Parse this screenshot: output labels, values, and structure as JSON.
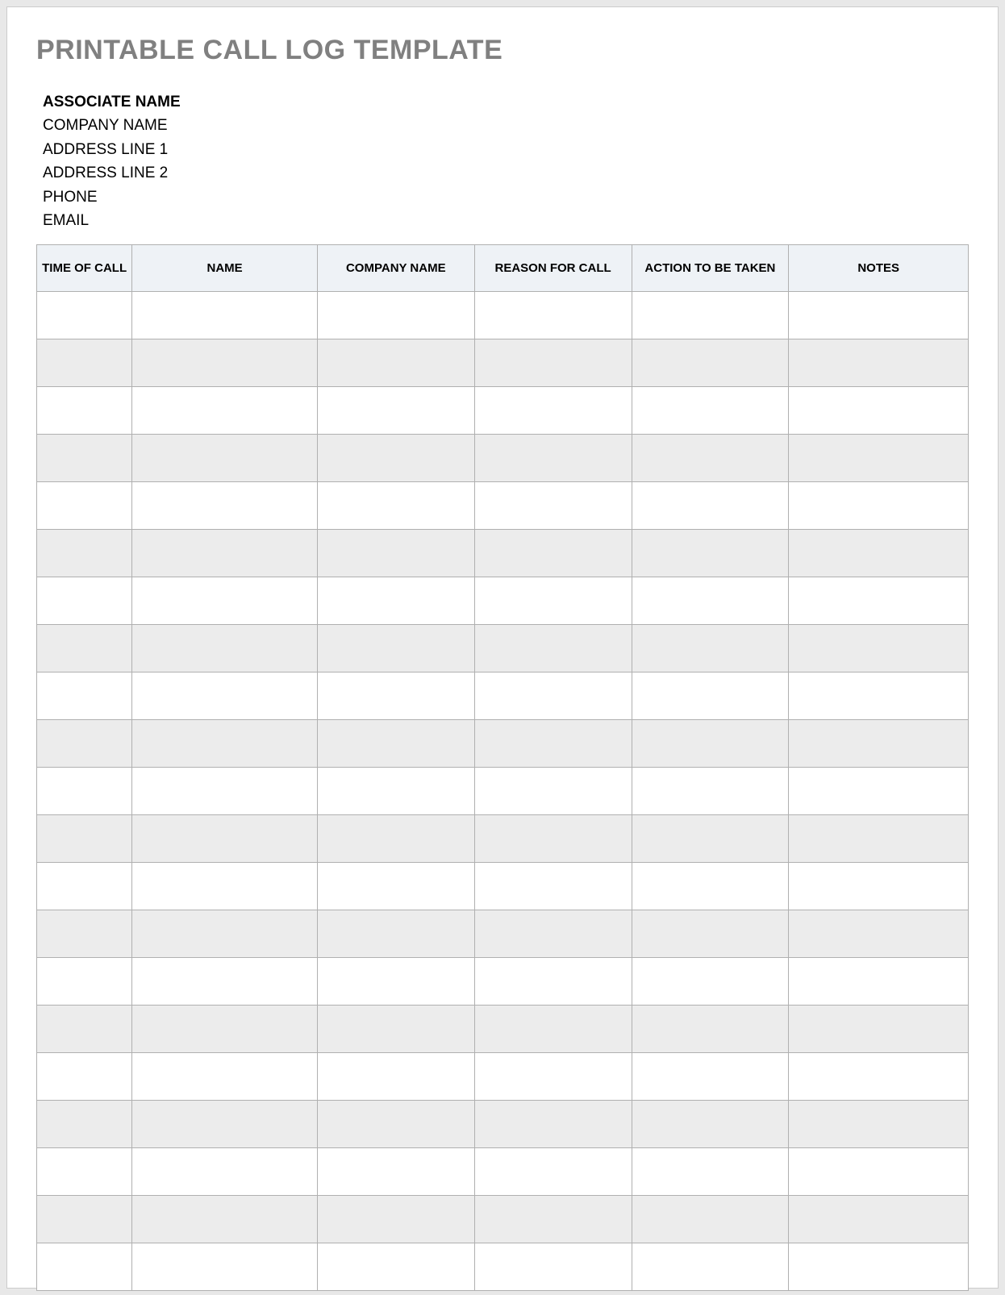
{
  "title": "PRINTABLE CALL LOG TEMPLATE",
  "info": {
    "associate_name": "ASSOCIATE NAME",
    "company_name": "COMPANY NAME",
    "address1": "ADDRESS LINE 1",
    "address2": "ADDRESS LINE 2",
    "phone": "PHONE",
    "email": "EMAIL"
  },
  "table": {
    "headers": {
      "time": "TIME OF CALL",
      "name": "NAME",
      "company": "COMPANY NAME",
      "reason": "REASON FOR CALL",
      "action": "ACTION TO BE TAKEN",
      "notes": "NOTES"
    },
    "rows": [
      {
        "time": "",
        "name": "",
        "company": "",
        "reason": "",
        "action": "",
        "notes": ""
      },
      {
        "time": "",
        "name": "",
        "company": "",
        "reason": "",
        "action": "",
        "notes": ""
      },
      {
        "time": "",
        "name": "",
        "company": "",
        "reason": "",
        "action": "",
        "notes": ""
      },
      {
        "time": "",
        "name": "",
        "company": "",
        "reason": "",
        "action": "",
        "notes": ""
      },
      {
        "time": "",
        "name": "",
        "company": "",
        "reason": "",
        "action": "",
        "notes": ""
      },
      {
        "time": "",
        "name": "",
        "company": "",
        "reason": "",
        "action": "",
        "notes": ""
      },
      {
        "time": "",
        "name": "",
        "company": "",
        "reason": "",
        "action": "",
        "notes": ""
      },
      {
        "time": "",
        "name": "",
        "company": "",
        "reason": "",
        "action": "",
        "notes": ""
      },
      {
        "time": "",
        "name": "",
        "company": "",
        "reason": "",
        "action": "",
        "notes": ""
      },
      {
        "time": "",
        "name": "",
        "company": "",
        "reason": "",
        "action": "",
        "notes": ""
      },
      {
        "time": "",
        "name": "",
        "company": "",
        "reason": "",
        "action": "",
        "notes": ""
      },
      {
        "time": "",
        "name": "",
        "company": "",
        "reason": "",
        "action": "",
        "notes": ""
      },
      {
        "time": "",
        "name": "",
        "company": "",
        "reason": "",
        "action": "",
        "notes": ""
      },
      {
        "time": "",
        "name": "",
        "company": "",
        "reason": "",
        "action": "",
        "notes": ""
      },
      {
        "time": "",
        "name": "",
        "company": "",
        "reason": "",
        "action": "",
        "notes": ""
      },
      {
        "time": "",
        "name": "",
        "company": "",
        "reason": "",
        "action": "",
        "notes": ""
      },
      {
        "time": "",
        "name": "",
        "company": "",
        "reason": "",
        "action": "",
        "notes": ""
      },
      {
        "time": "",
        "name": "",
        "company": "",
        "reason": "",
        "action": "",
        "notes": ""
      },
      {
        "time": "",
        "name": "",
        "company": "",
        "reason": "",
        "action": "",
        "notes": ""
      },
      {
        "time": "",
        "name": "",
        "company": "",
        "reason": "",
        "action": "",
        "notes": ""
      },
      {
        "time": "",
        "name": "",
        "company": "",
        "reason": "",
        "action": "",
        "notes": ""
      }
    ]
  }
}
